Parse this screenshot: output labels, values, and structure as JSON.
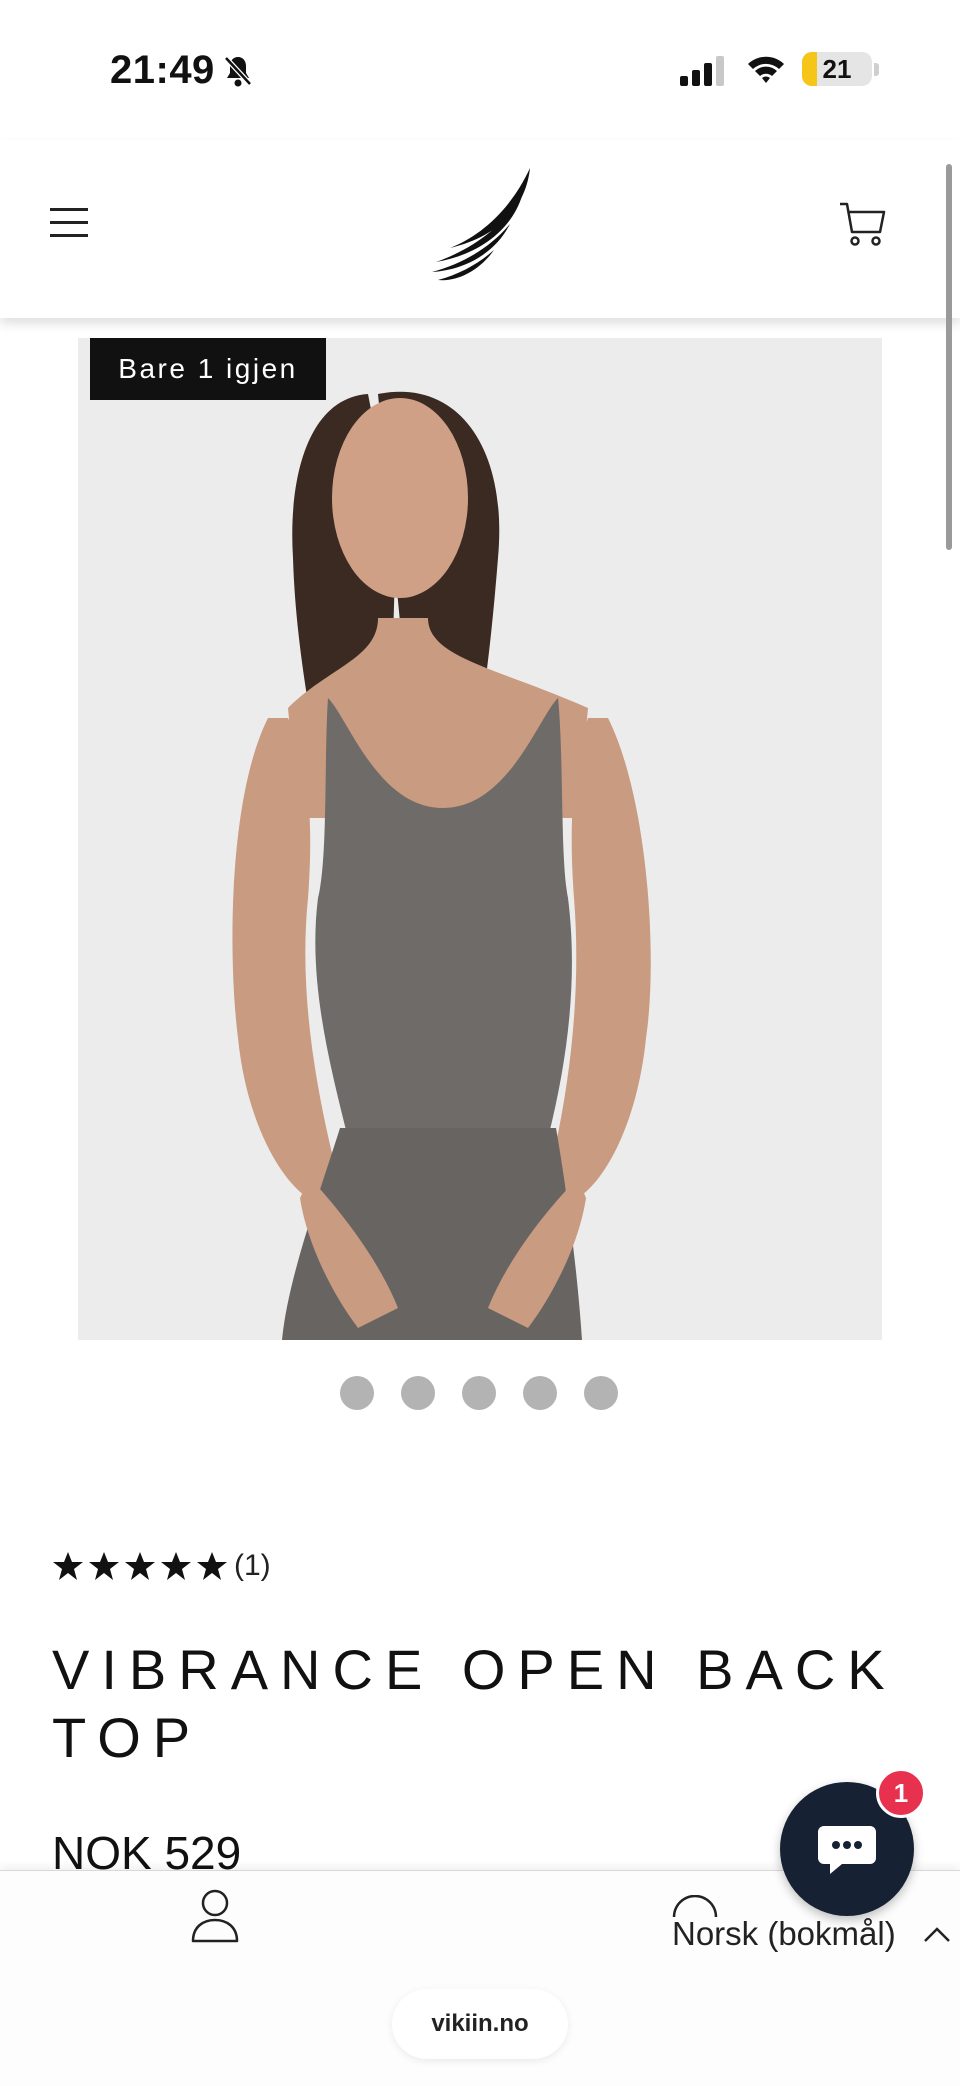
{
  "status_bar": {
    "time": "21:49",
    "battery_level": "21",
    "battery_fraction": 0.21,
    "icons": [
      "bell-slash-icon",
      "signal-icon",
      "wifi-icon",
      "battery-icon"
    ]
  },
  "header": {
    "icons": [
      "menu-icon",
      "logo-wing-icon",
      "cart-icon"
    ]
  },
  "product": {
    "badge": "Bare 1 igjen",
    "image_count": 5,
    "rating_stars": 5,
    "rating_count": "(1)",
    "title": "VIBRANCE OPEN BACK TOP",
    "price": "NOK 529",
    "colors": {
      "garment": "#6e6b69",
      "background": "#ececec"
    }
  },
  "bottom_bar": {
    "language": "Norsk (bokmål)",
    "url": "vikiin.no",
    "icons": [
      "account-icon",
      "chevron-up-icon"
    ]
  },
  "chat": {
    "unread_count": "1",
    "colors": {
      "button": "#162133",
      "badge": "#e8304f"
    }
  }
}
